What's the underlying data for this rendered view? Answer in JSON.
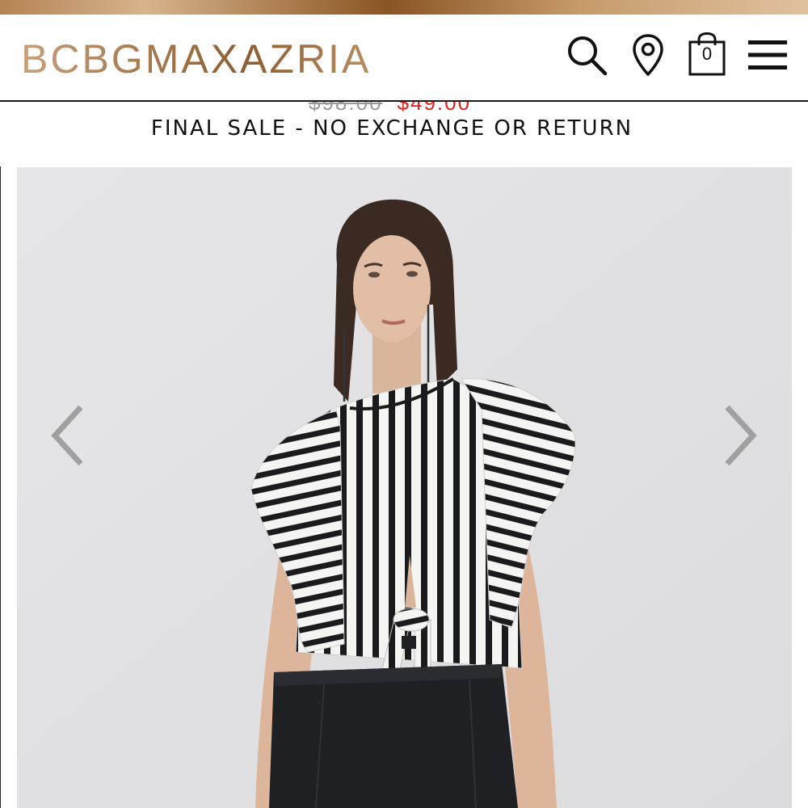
{
  "header": {
    "brand": "BCBGMAXAZRIA",
    "cart_count": "0",
    "icons": [
      "search-icon",
      "location-pin-icon",
      "shopping-bag-icon",
      "menu-icon"
    ]
  },
  "product": {
    "price_original": "$98.00",
    "price_sale": "$49.00",
    "sale_notice": "FINAL SALE - NO EXCHANGE OR RETURN"
  },
  "gallery": {
    "prev_icon": "chevron-left-icon",
    "next_icon": "chevron-right-icon",
    "image_subject": "striped flutter-sleeve tie-front top"
  },
  "colors": {
    "brand_gold": "#a87a4e",
    "sale_red": "#e0201c",
    "gallery_bg": "#e4e4e6",
    "arrow_gray": "#a0a0a0"
  }
}
